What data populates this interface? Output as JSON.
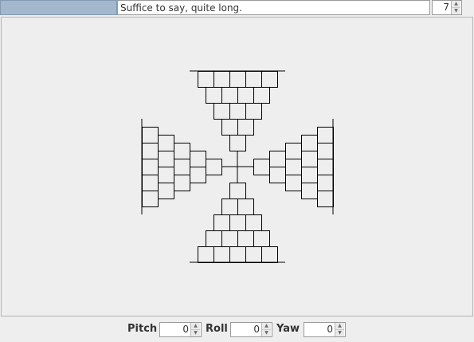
{
  "top_bar": {
    "progress_fraction": 0.25,
    "title_text": "Suffice to say, quite long.",
    "level_value": "7"
  },
  "controls": {
    "pitch": {
      "label": "Pitch",
      "value": "0"
    },
    "roll": {
      "label": "Roll",
      "value": "0"
    },
    "yaw": {
      "label": "Yaw",
      "value": "0"
    }
  },
  "icons": {
    "spinner_up": "▲",
    "spinner_down": "▼"
  },
  "colors": {
    "progress_fill": "#a3b8cc",
    "line": "#000000",
    "background": "#eeeeee"
  }
}
